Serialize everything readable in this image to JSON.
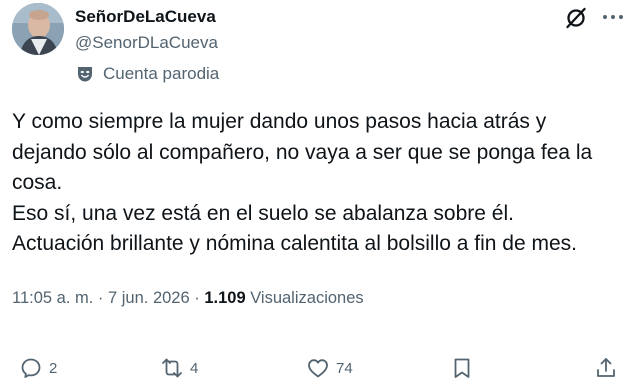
{
  "author": {
    "name": "SeñorDeLaCueva",
    "handle": "@SenorDLaCueva",
    "badge_label": "Cuenta parodia"
  },
  "post": {
    "lines": [
      "Y como siempre la mujer dando unos pasos hacia atrás y",
      "dejando sólo al compañero, no vaya a ser que se ponga fea la",
      "cosa.",
      "Eso sí, una vez está en el suelo se abalanza sobre él.",
      "Actuación brillante y nómina calentita al bolsillo a fin de mes."
    ],
    "time": "11:05 a. m.",
    "separator1": " · ",
    "date": "7 jun. 2026",
    "separator2": " · ",
    "views_count": "1.109",
    "views_label": " Visualizaciones"
  },
  "actions": {
    "replies": "2",
    "reposts": "4",
    "likes": "74"
  },
  "icons": {
    "parody": "mask-icon",
    "grok": "grok-icon",
    "more": "more-icon",
    "reply": "reply-icon",
    "repost": "repost-icon",
    "like": "heart-icon",
    "bookmark": "bookmark-icon",
    "share": "share-icon"
  },
  "colors": {
    "text": "#0f1419",
    "secondary": "#536471"
  }
}
